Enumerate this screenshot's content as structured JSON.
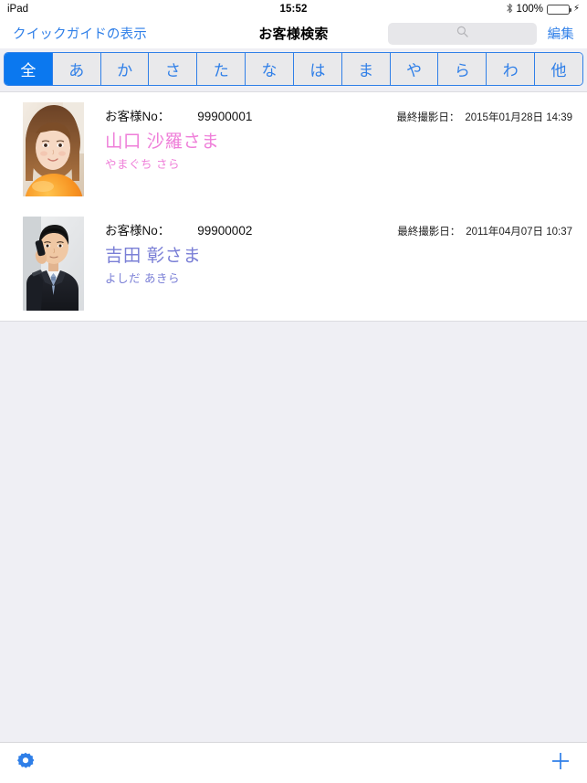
{
  "status_bar": {
    "carrier": "iPad",
    "time": "15:52",
    "bluetooth_icon": "bluetooth-icon",
    "battery_percent": "100%",
    "battery_level": 100,
    "charging_icon": "charging-bolt-icon",
    "battery_color": "#4CD964"
  },
  "nav_bar": {
    "left_button": "クイックガイドの表示",
    "title": "お客様検索",
    "search": {
      "value": "",
      "placeholder": "",
      "icon": "search-icon"
    },
    "edit_button": "編集",
    "tint_color": "#2f7fe8"
  },
  "tab_bar": {
    "selected_index": 0,
    "selected_color": "#0b78ef",
    "tabs": [
      {
        "label": "全"
      },
      {
        "label": "あ"
      },
      {
        "label": "か"
      },
      {
        "label": "さ"
      },
      {
        "label": "た"
      },
      {
        "label": "な"
      },
      {
        "label": "は"
      },
      {
        "label": "ま"
      },
      {
        "label": "や"
      },
      {
        "label": "ら"
      },
      {
        "label": "わ"
      },
      {
        "label": "他"
      }
    ]
  },
  "list": {
    "customer_no_label": "お客様No：",
    "last_shoot_label": "最終撮影日：",
    "rows": [
      {
        "customer_no": "99900001",
        "name": "山口 沙羅さま",
        "kana": "やまぐち さら",
        "name_color": "#ef7fd9",
        "last_shoot_date": "2015年01月28日 14:39",
        "photo": "portrait-woman-orange"
      },
      {
        "customer_no": "99900002",
        "name": "吉田 彰さま",
        "kana": "よしだ あきら",
        "name_color": "#7a7fd6",
        "last_shoot_date": "2011年04月07日 10:37",
        "photo": "portrait-man-suit-phone"
      }
    ]
  },
  "toolbar": {
    "settings_icon": "gear-icon",
    "add_icon": "plus-icon",
    "tint_color": "#2f7fe8"
  }
}
